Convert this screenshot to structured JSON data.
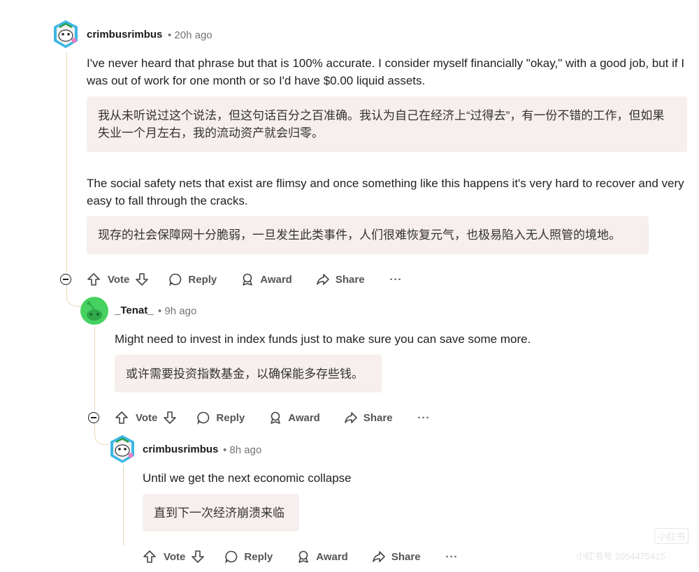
{
  "comments": [
    {
      "author": "crimbusrimbus",
      "time": "• 20h ago",
      "paragraphs": [
        {
          "text": "I've never heard that phrase but that is 100% accurate. I consider myself financially \"okay,\" with a good job, but if I was out of work for one month or so I'd have $0.00 liquid assets.",
          "translation": "我从未听说过这个说法，但这句话百分之百准确。我认为自己在经济上“过得去”，有一份不错的工作，但如果失业一个月左右，我的流动资产就会归零。"
        },
        {
          "text": "The social safety nets that exist are flimsy and once something like this happens it's very hard to recover and very easy to fall through the cracks.",
          "translation": "现存的社会保障网十分脆弱，一旦发生此类事件，人们很难恢复元气，也极易陷入无人照管的境地。"
        }
      ]
    },
    {
      "author": "_Tenat_",
      "time": "• 9h ago",
      "paragraphs": [
        {
          "text": "Might need to invest in index funds just to make sure you can save some more.",
          "translation": "或许需要投资指数基金，以确保能多存些钱。"
        }
      ]
    },
    {
      "author": "crimbusrimbus",
      "time": "• 8h ago",
      "paragraphs": [
        {
          "text": "Until we get the next economic collapse",
          "translation": "直到下一次经济崩溃来临"
        }
      ]
    }
  ],
  "actions": {
    "vote": "Vote",
    "reply": "Reply",
    "award": "Award",
    "share": "Share",
    "more": "···"
  },
  "watermark": {
    "line1": "小红书",
    "line2": "小红书号 2054475415"
  },
  "colors": {
    "translation_bg": "#f6efed",
    "thread_line": "#e7d9b3",
    "tenat_avatar": "#46d160"
  }
}
